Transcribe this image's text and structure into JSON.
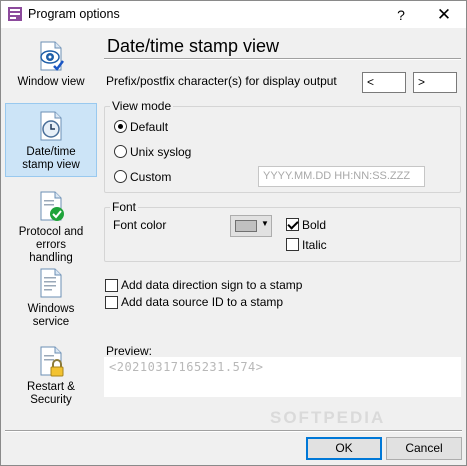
{
  "window": {
    "title": "Program options",
    "help_glyph": "?",
    "close_glyph": "✕"
  },
  "sidebar": {
    "items": [
      {
        "label": "Window view",
        "icon": "window-view-icon"
      },
      {
        "label": "Date/time stamp view",
        "icon": "clock-document-icon",
        "active": true
      },
      {
        "label": "Protocol and errors handling",
        "icon": "checkmark-document-icon"
      },
      {
        "label": "Windows service",
        "icon": "service-document-icon"
      },
      {
        "label": "Restart & Security",
        "icon": "lock-document-icon"
      }
    ]
  },
  "page": {
    "title": "Date/time stamp view",
    "prefix_label": "Prefix/postfix character(s) for display output",
    "prefix_value": "<",
    "postfix_value": ">"
  },
  "view_mode": {
    "caption": "View mode",
    "options": [
      {
        "label": "Default",
        "checked": true
      },
      {
        "label": "Unix syslog",
        "checked": false
      },
      {
        "label": "Custom",
        "checked": false
      }
    ],
    "custom_placeholder": "YYYY.MM.DD HH:NN:SS.ZZZ"
  },
  "font": {
    "caption": "Font",
    "color_label": "Font color",
    "color_value": "#c0c0c0",
    "bold_label": "Bold",
    "bold_checked": true,
    "italic_label": "Italic",
    "italic_checked": false
  },
  "options": {
    "direction_sign_label": "Add data direction sign to a stamp",
    "direction_sign_checked": false,
    "source_id_label": "Add data source ID to a stamp",
    "source_id_checked": false
  },
  "preview": {
    "label": "Preview:",
    "text": "<20210317165231.574>"
  },
  "buttons": {
    "ok": "OK",
    "cancel": "Cancel"
  },
  "watermark": "SOFTPEDIA"
}
